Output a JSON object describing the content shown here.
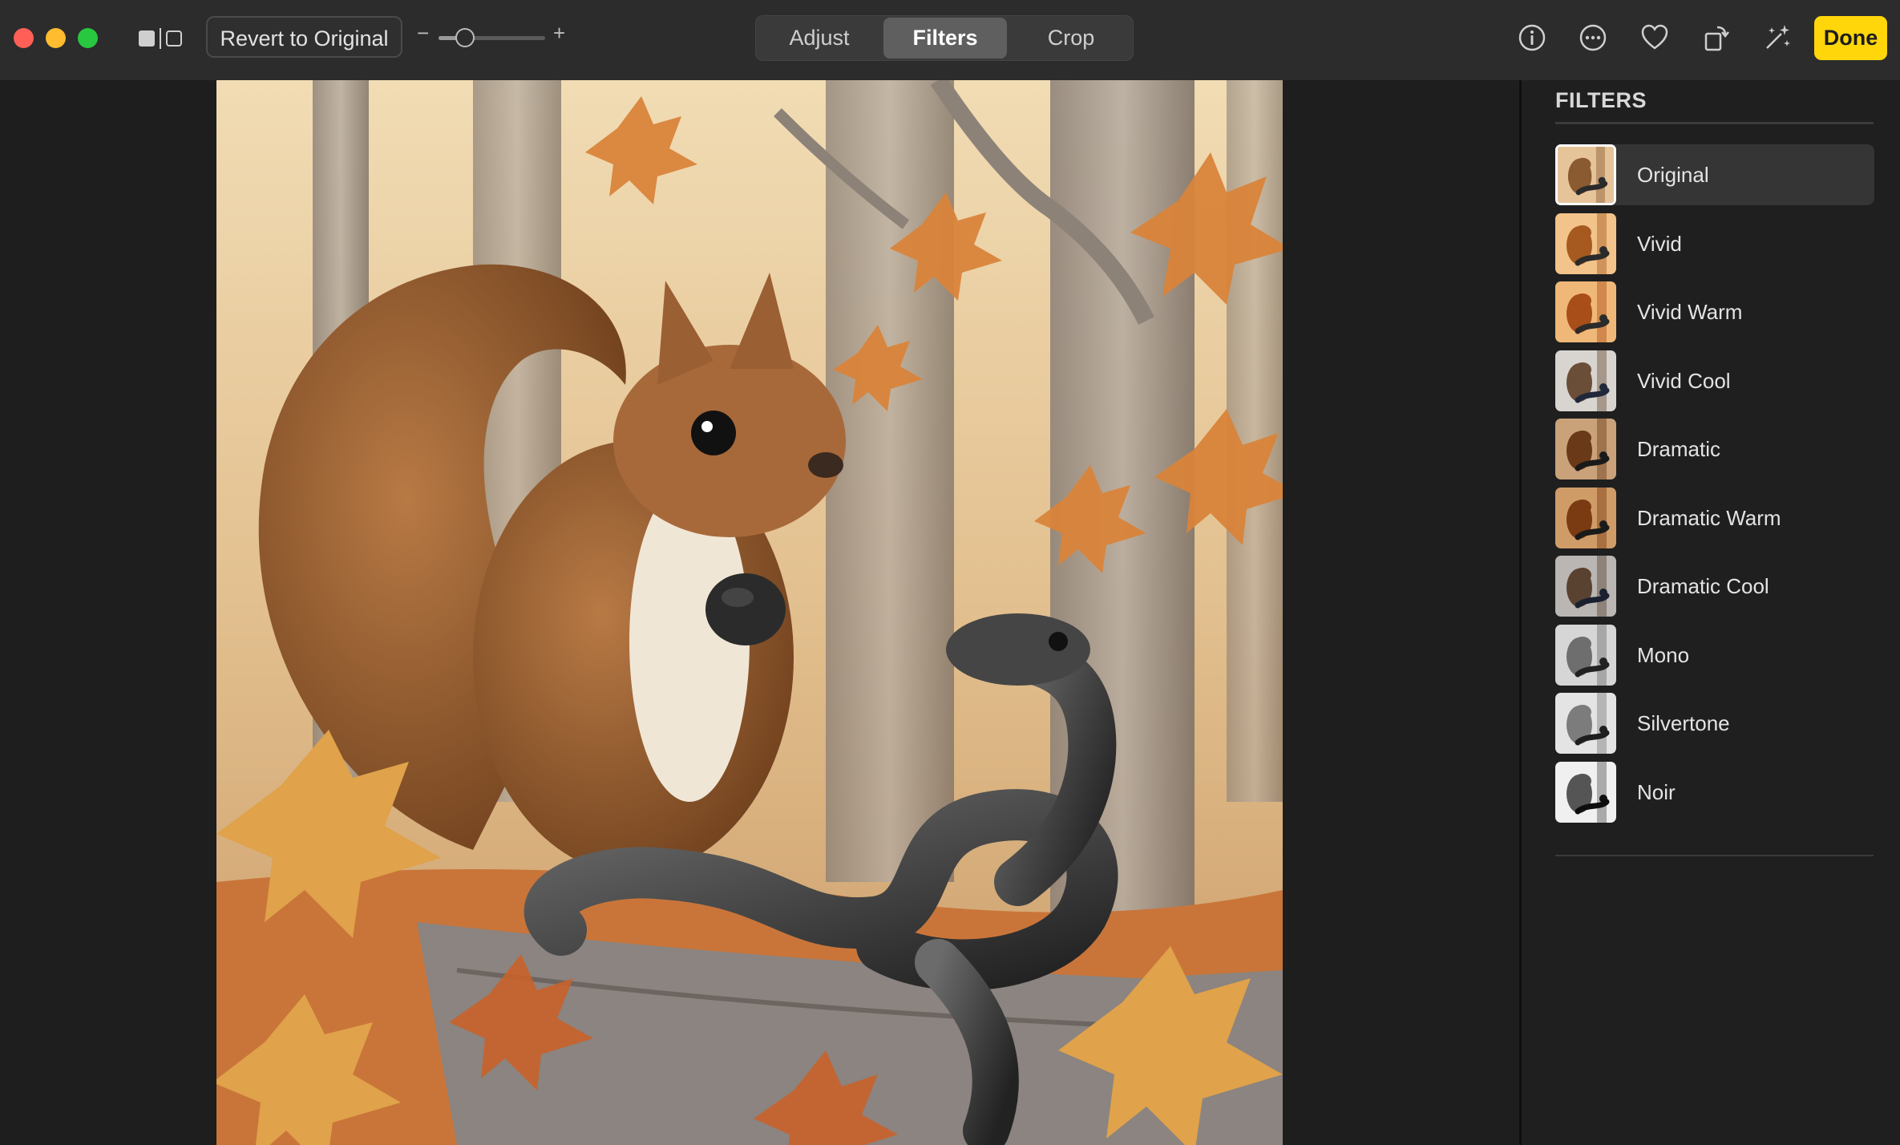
{
  "toolbar": {
    "revert_label": "Revert to Original",
    "zoom_minus": "−",
    "zoom_plus": "+",
    "zoom_level": 0.25,
    "tabs": [
      {
        "label": "Adjust",
        "selected": false
      },
      {
        "label": "Filters",
        "selected": true
      },
      {
        "label": "Crop",
        "selected": false
      }
    ],
    "icons": [
      "info-icon",
      "more-icon",
      "heart-icon",
      "rotate-icon",
      "magic-wand-icon"
    ],
    "done_label": "Done"
  },
  "sidebar": {
    "title": "FILTERS",
    "filters": [
      {
        "label": "Original",
        "selected": true,
        "tone": "original"
      },
      {
        "label": "Vivid",
        "selected": false,
        "tone": "vivid"
      },
      {
        "label": "Vivid Warm",
        "selected": false,
        "tone": "warm"
      },
      {
        "label": "Vivid Cool",
        "selected": false,
        "tone": "cool"
      },
      {
        "label": "Dramatic",
        "selected": false,
        "tone": "dramatic"
      },
      {
        "label": "Dramatic Warm",
        "selected": false,
        "tone": "dwarm"
      },
      {
        "label": "Dramatic Cool",
        "selected": false,
        "tone": "dcool"
      },
      {
        "label": "Mono",
        "selected": false,
        "tone": "mono"
      },
      {
        "label": "Silvertone",
        "selected": false,
        "tone": "silver"
      },
      {
        "label": "Noir",
        "selected": false,
        "tone": "noir"
      }
    ]
  },
  "colors": {
    "accent_done": "#ffd60a",
    "toolbar_bg": "#2c2c2c",
    "window_bg": "#1e1e1e"
  }
}
